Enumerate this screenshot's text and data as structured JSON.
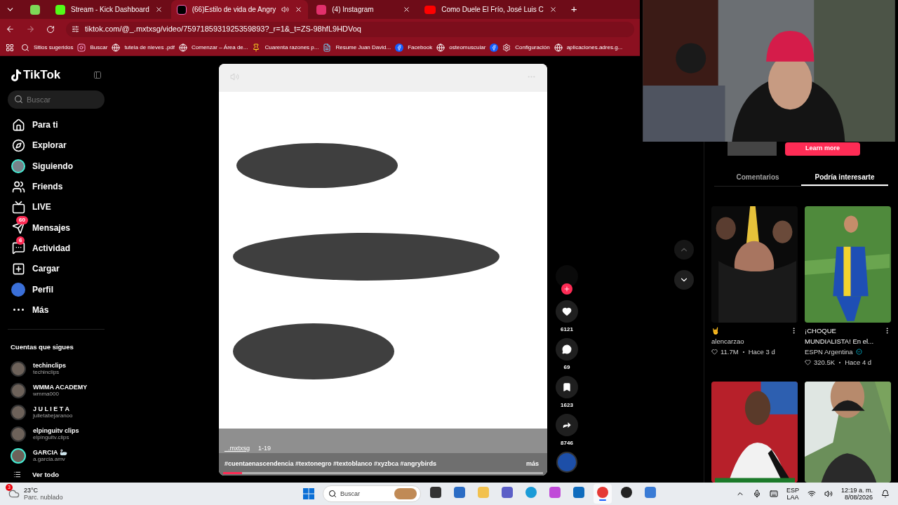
{
  "browser": {
    "tabs": [
      {
        "kind": "pinned",
        "selected": false,
        "audible": false,
        "color": "#7ed957"
      },
      {
        "kind": "kick",
        "title": "Stream - Kick Dashboard",
        "selected": false,
        "audible": false,
        "color": "#53fc18"
      },
      {
        "kind": "tiktok",
        "title": "(66)Estilo de vida de Angry",
        "selected": true,
        "audible": true,
        "color": "#000000"
      },
      {
        "kind": "instagram",
        "title": "(4) Instagram",
        "selected": false,
        "audible": false,
        "color": "#e1306c"
      },
      {
        "kind": "youtube",
        "title": "Como Duele El Frío, José Luis C",
        "selected": false,
        "audible": false,
        "color": "#ff0000"
      }
    ],
    "new_tab": "+",
    "nav": {
      "back_disabled": false,
      "forward_disabled": true
    },
    "url": "tiktok.com/@_.mxtxsg/video/7597185931925359893?_r=1&_t=ZS-98hfL9HDVoq",
    "bookmarks": [
      {
        "kind": "search",
        "label": "Sitios sugeridos"
      },
      {
        "kind": "instagram",
        "label": "Buscar"
      },
      {
        "kind": "globe",
        "label": "tutela de nieves .pdf"
      },
      {
        "kind": "globe",
        "label": "Comenzar – Área de..."
      },
      {
        "kind": "pin",
        "label": "Cuarenta razones p..."
      },
      {
        "kind": "cv",
        "label": "Resume Juan David..."
      },
      {
        "kind": "facebook",
        "label": "Facebook"
      },
      {
        "kind": "globe",
        "label": "osteomuscular"
      },
      {
        "kind": "facebook"
      },
      {
        "kind": "gear",
        "label": "Configuración"
      },
      {
        "kind": "globe",
        "label": "aplicaciones.adres.g..."
      }
    ]
  },
  "sidebar": {
    "logo": "TikTok",
    "search": {
      "placeholder": "Buscar"
    },
    "nav": [
      {
        "kind": "home",
        "label": "Para ti"
      },
      {
        "kind": "compass",
        "label": "Explorar"
      },
      {
        "kind": "avatar",
        "label": "Siguiendo"
      },
      {
        "kind": "friends",
        "label": "Friends"
      },
      {
        "kind": "live",
        "label": "LIVE"
      },
      {
        "kind": "messages",
        "label": "Mensajes",
        "badge": "60"
      },
      {
        "kind": "activity",
        "label": "Actividad",
        "badge": "6"
      },
      {
        "kind": "upload",
        "label": "Cargar"
      },
      {
        "kind": "profile",
        "label": "Perfil"
      },
      {
        "kind": "more",
        "label": "Más"
      }
    ],
    "following_title": "Cuentas que sigues",
    "following": [
      {
        "name": "techinclips",
        "handle": "techinclips",
        "ring": false
      },
      {
        "name": "WMMA ACADEMY",
        "handle": "wmma000",
        "ring": false
      },
      {
        "name": "J U L I E T A",
        "handle": "julietabejaranoo",
        "ring": false
      },
      {
        "name": "elpinguitv clips",
        "handle": "elpinguitv.clips",
        "ring": false
      },
      {
        "name": "GARCIA 🦢",
        "handle": "a.garcia.amv",
        "ring": true
      }
    ],
    "see_all": "Ver todo"
  },
  "video": {
    "kind": "picture",
    "author": "_.mxtxsg",
    "date": "1-19",
    "hashtags": "#cuentaenascendencia #textonegro #textoblanco #xyzbca #angrybirds",
    "more": "más",
    "progress": {
      "level": 0.06
    }
  },
  "actions": [
    {
      "kind": "like",
      "count": "6121"
    },
    {
      "kind": "comment",
      "count": "69"
    },
    {
      "kind": "bookmark",
      "count": "1623"
    },
    {
      "kind": "share",
      "count": "8746"
    }
  ],
  "right_panel": {
    "ad_button": "Learn more",
    "tabs": [
      {
        "label": "Comentarios",
        "selected": false
      },
      {
        "label": "Podría interesarte",
        "selected": true
      }
    ],
    "cards": [
      {
        "kind": "night",
        "title": "🤘",
        "author": "alencarzao",
        "verified": false,
        "likes": "11.7M",
        "time": "Hace 3 d"
      },
      {
        "kind": "field",
        "title": "¡CHOQUE MUNDIALISTA! En el...",
        "author": "ESPN Argentina",
        "verified": true,
        "likes": "320.5K",
        "time": "Hace 4 d"
      },
      {
        "kind": "studio"
      },
      {
        "kind": "outdoor"
      }
    ]
  },
  "taskbar": {
    "weather": {
      "badge": "3",
      "temp": "23°C",
      "condition": "Parc. nublado"
    },
    "search": {
      "placeholder": "Buscar"
    },
    "apps": [
      {
        "kind": "taskview",
        "active": false
      },
      {
        "kind": "store",
        "active": false
      },
      {
        "kind": "folder",
        "active": false
      },
      {
        "kind": "teams",
        "active": false
      },
      {
        "kind": "edge",
        "active": false
      },
      {
        "kind": "copilot",
        "active": false
      },
      {
        "kind": "outlook",
        "active": false
      },
      {
        "kind": "chrome",
        "active": true
      },
      {
        "kind": "obs",
        "active": false
      },
      {
        "kind": "tile",
        "active": false
      }
    ],
    "lang": "ESP",
    "layout": "LAA",
    "time": "12:19 a. m.",
    "date": "8/08/2026"
  }
}
